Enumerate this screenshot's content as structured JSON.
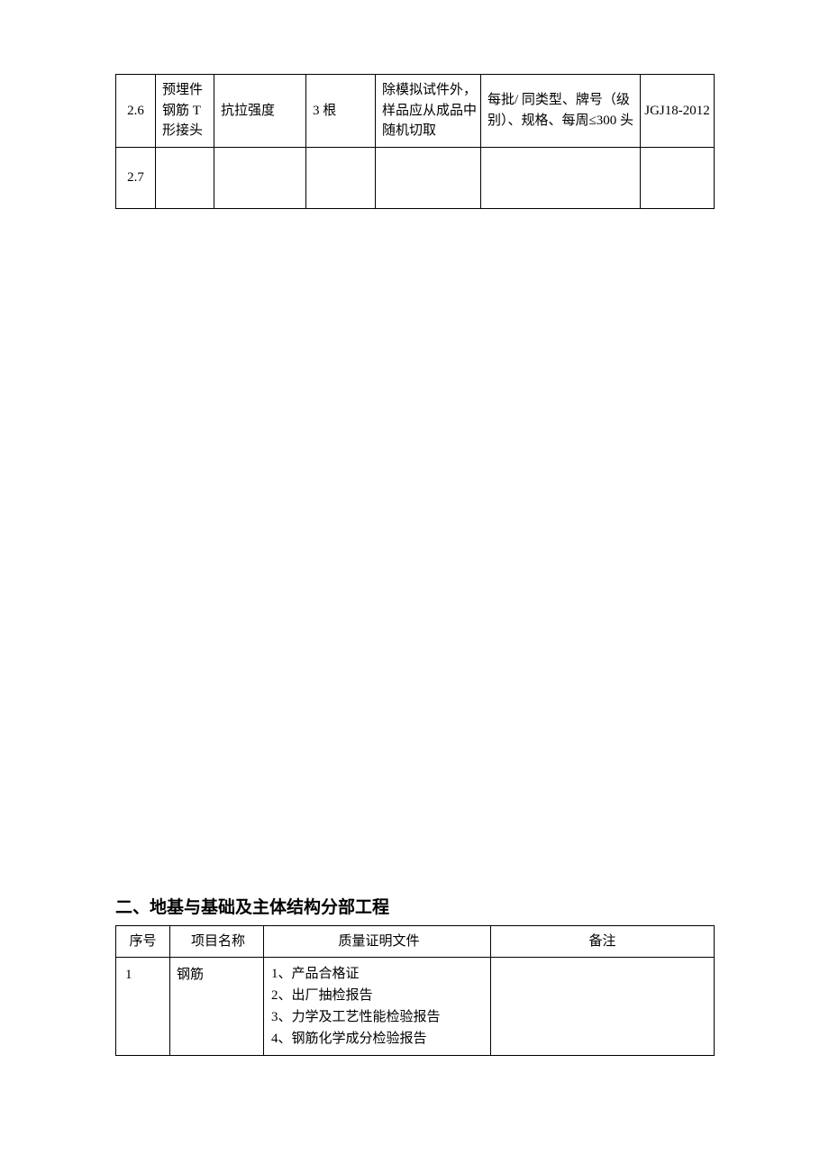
{
  "table1": {
    "rows": [
      {
        "num": "2.6",
        "name": "预埋件钢筋 T 形接头",
        "param": "抗拉强度",
        "qty": "3 根",
        "note1": "除模拟试件外，样品应从成品中随机切取",
        "note2": "每批/ 同类型、牌号（级别）、规格、每周≤300 头",
        "std": "JGJ18-2012"
      },
      {
        "num": "2.7",
        "name": "",
        "param": "",
        "qty": "",
        "note1": "",
        "note2": "",
        "std": ""
      }
    ]
  },
  "section2": {
    "title": "二、地基与基础及主体结构分部工程",
    "headers": {
      "num": "序号",
      "name": "项目名称",
      "doc": "质量证明文件",
      "remark": "备注"
    },
    "rows": [
      {
        "num": "1",
        "name": "钢筋",
        "doc": "1、产品合格证\n2、出厂抽检报告\n3、力学及工艺性能检验报告\n4、钢筋化学成分检验报告",
        "remark": ""
      }
    ]
  }
}
